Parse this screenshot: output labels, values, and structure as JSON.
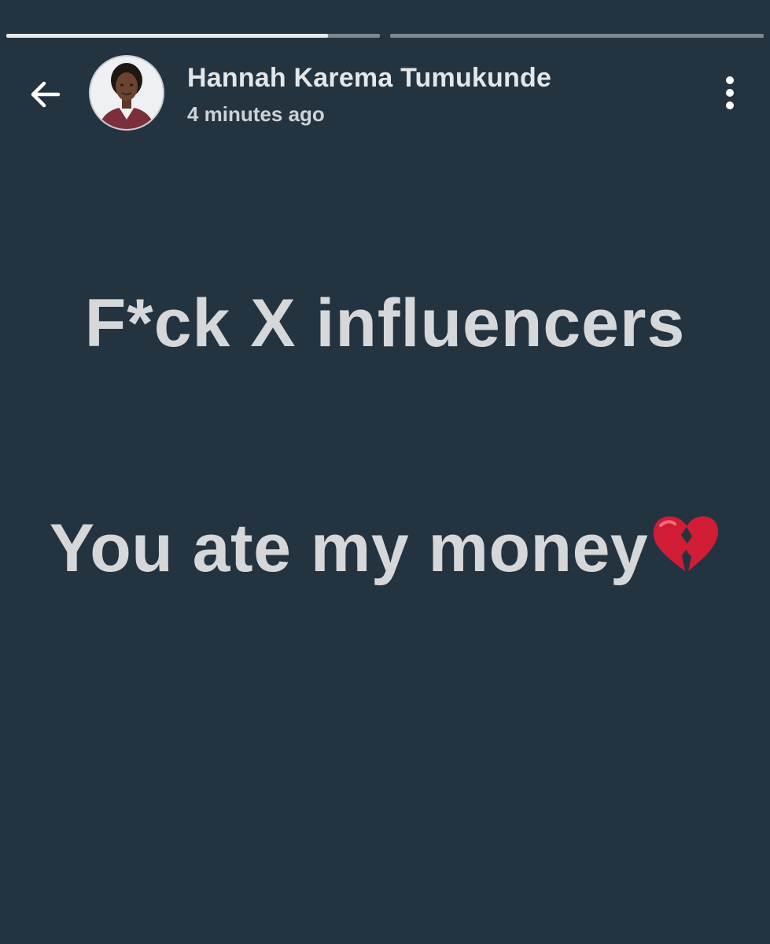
{
  "story": {
    "progress_segments": [
      {
        "fraction": 0.86
      },
      {
        "fraction": 0.0
      }
    ],
    "user": {
      "name": "Hannah Karema Tumukunde",
      "timestamp": "4 minutes ago"
    },
    "text_line_1": "F*ck X influencers",
    "text_line_2": "You ate my money",
    "text_line_2_emoji": "broken-heart-icon"
  },
  "colors": {
    "background": "#233340",
    "text": "#d6d7d9",
    "broken_heart": "#d01c35"
  },
  "icons": {
    "back": "arrow-left-icon",
    "more": "more-vertical-icon"
  }
}
